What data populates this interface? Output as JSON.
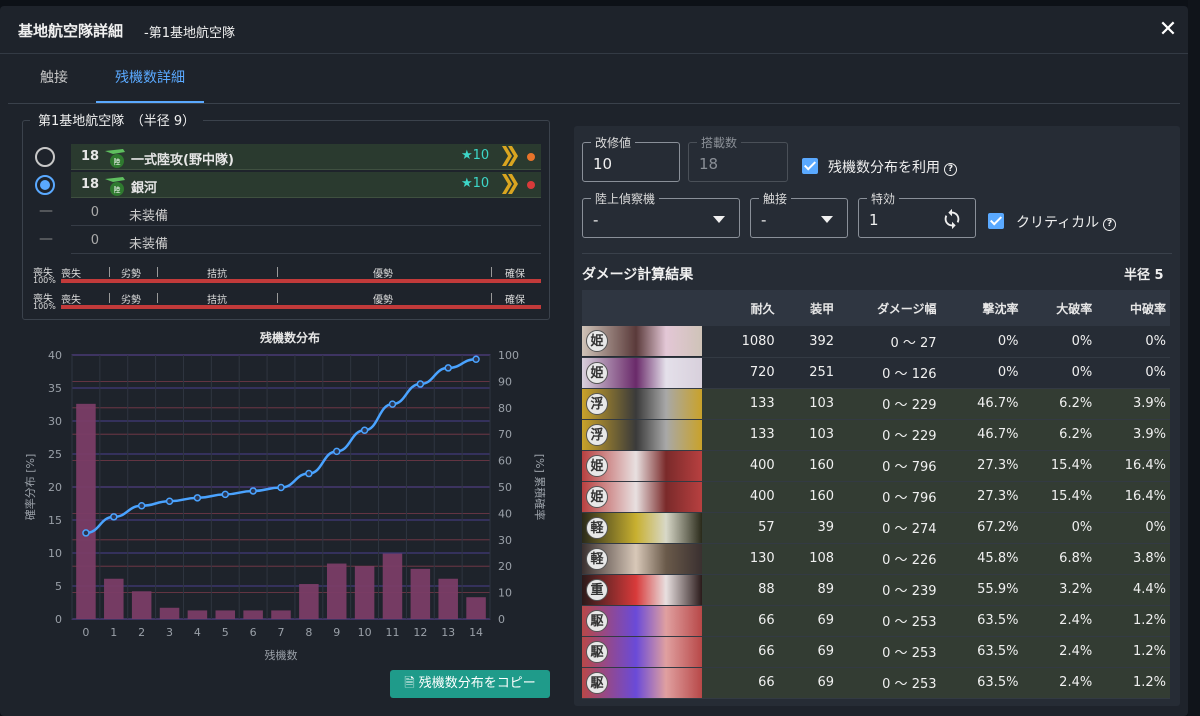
{
  "dialog": {
    "title": "基地航空隊詳細",
    "subtitle": "-第1基地航空隊",
    "close_icon": "close-icon"
  },
  "tabs": [
    {
      "label": "触接"
    },
    {
      "label": "残機数詳細"
    }
  ],
  "fleet": {
    "legend": "第1基地航空隊　（半径 9）",
    "slots": [
      {
        "count": "18",
        "name": "一式陸攻(野中隊)",
        "stars": "★10",
        "dot_color": "#e8742a",
        "selected": false
      },
      {
        "count": "18",
        "name": "銀河",
        "stars": "★10",
        "dot_color": "#d83a3a",
        "selected": true
      },
      {
        "count": "0",
        "name": "未装備"
      },
      {
        "count": "0",
        "name": "未装備"
      }
    ],
    "air_state_labels": [
      "喪失",
      "劣勢",
      "拮抗",
      "優勢",
      "確保"
    ],
    "air_state_rows": [
      {
        "label": "喪失",
        "pct": "100%"
      },
      {
        "label": "喪失",
        "pct": "100%"
      }
    ]
  },
  "chart_data": {
    "type": "bar",
    "title": "残機数分布",
    "xlabel": "残機数",
    "ylabel": "確率分布 [%]",
    "y2label": "[%] 累積確率",
    "categories": [
      0,
      1,
      2,
      3,
      4,
      5,
      6,
      7,
      8,
      9,
      10,
      11,
      12,
      13,
      14
    ],
    "ylim": [
      0,
      40
    ],
    "yticks": [
      0,
      5,
      10,
      15,
      20,
      25,
      30,
      35,
      40
    ],
    "y2lim": [
      0,
      100
    ],
    "y2ticks": [
      0,
      10,
      20,
      30,
      40,
      50,
      60,
      70,
      80,
      90,
      100
    ],
    "series": [
      {
        "kind": "bar",
        "color": "#7a3d66",
        "values": [
          32.6,
          6.1,
          4.2,
          1.7,
          1.3,
          1.3,
          1.3,
          1.3,
          5.3,
          8.4,
          8.0,
          9.9,
          7.6,
          6.1,
          3.3
        ]
      },
      {
        "kind": "line",
        "axis": "y2",
        "color": "#4aa3ff",
        "values": [
          32.6,
          38.7,
          42.9,
          44.6,
          45.9,
          47.2,
          48.5,
          49.8,
          55.1,
          63.5,
          71.5,
          81.4,
          89.0,
          95.1,
          98.4
        ]
      }
    ]
  },
  "copy_button": "残機数分布をコピー",
  "form": {
    "kaishu_label": "改修値",
    "kaishu_value": "10",
    "tousai_label": "搭載数",
    "tousai_value": "18",
    "use_dist_label": "残機数分布を利用",
    "rikujou_label": "陸上偵察機",
    "rikujou_value": "-",
    "shokusetsu_label": "触接",
    "shokusetsu_value": "-",
    "tokkou_label": "特効",
    "tokkou_value": "1",
    "critical_label": "クリティカル"
  },
  "results": {
    "title": "ダメージ計算結果",
    "radius": "半径 5",
    "columns": [
      "",
      "耐久",
      "装甲",
      "ダメージ幅",
      "撃沈率",
      "大破率",
      "中破率"
    ],
    "rows": [
      {
        "tag": "姫",
        "hp": "1080",
        "armor": "392",
        "dmg": "0 ～ 27",
        "sink": "0%",
        "taiha": "0%",
        "chuuha": "0%",
        "img": [
          "#cfc3b8",
          "#5a3a3a",
          "#e3c7d6"
        ]
      },
      {
        "tag": "姫",
        "hp": "720",
        "armor": "251",
        "dmg": "0 ～ 126",
        "sink": "0%",
        "taiha": "0%",
        "chuuha": "0%",
        "img": [
          "#d8d0dc",
          "#6a2a6a",
          "#e4e0ea"
        ]
      },
      {
        "tag": "浮",
        "hp": "133",
        "armor": "103",
        "dmg": "0 ～ 229",
        "sink": "46.7%",
        "taiha": "6.2%",
        "chuuha": "3.9%",
        "img": [
          "#c9a22a",
          "#3a3a3a",
          "#a8a8a8"
        ]
      },
      {
        "tag": "浮",
        "hp": "133",
        "armor": "103",
        "dmg": "0 ～ 229",
        "sink": "46.7%",
        "taiha": "6.2%",
        "chuuha": "3.9%",
        "img": [
          "#c9a22a",
          "#3a3a3a",
          "#a8a8a8"
        ]
      },
      {
        "tag": "姫",
        "hp": "400",
        "armor": "160",
        "dmg": "0 ～ 796",
        "sink": "27.3%",
        "taiha": "15.4%",
        "chuuha": "16.4%",
        "img": [
          "#b84040",
          "#e8e0e0",
          "#7a2a2a"
        ]
      },
      {
        "tag": "姫",
        "hp": "400",
        "armor": "160",
        "dmg": "0 ～ 796",
        "sink": "27.3%",
        "taiha": "15.4%",
        "chuuha": "16.4%",
        "img": [
          "#b84040",
          "#e8e0e0",
          "#7a2a2a"
        ]
      },
      {
        "tag": "軽",
        "hp": "57",
        "armor": "39",
        "dmg": "0 ～ 274",
        "sink": "67.2%",
        "taiha": "0%",
        "chuuha": "0%",
        "img": [
          "#2a2a1a",
          "#c8b030",
          "#d8d8c8"
        ]
      },
      {
        "tag": "軽",
        "hp": "130",
        "armor": "108",
        "dmg": "0 ～ 226",
        "sink": "45.8%",
        "taiha": "6.8%",
        "chuuha": "3.8%",
        "img": [
          "#3a3030",
          "#d8c8b8",
          "#6a5a4a"
        ]
      },
      {
        "tag": "重",
        "hp": "88",
        "armor": "89",
        "dmg": "0 ～ 239",
        "sink": "55.9%",
        "taiha": "3.2%",
        "chuuha": "4.4%",
        "img": [
          "#2a1a1a",
          "#d83a3a",
          "#e8e0e0"
        ]
      },
      {
        "tag": "駆",
        "hp": "66",
        "armor": "69",
        "dmg": "0 ～ 253",
        "sink": "63.5%",
        "taiha": "2.4%",
        "chuuha": "1.2%",
        "img": [
          "#b84848",
          "#6a4ad8",
          "#e0a0a0"
        ]
      },
      {
        "tag": "駆",
        "hp": "66",
        "armor": "69",
        "dmg": "0 ～ 253",
        "sink": "63.5%",
        "taiha": "2.4%",
        "chuuha": "1.2%",
        "img": [
          "#b84848",
          "#6a4ad8",
          "#e0a0a0"
        ]
      },
      {
        "tag": "駆",
        "hp": "66",
        "armor": "69",
        "dmg": "0 ～ 253",
        "sink": "63.5%",
        "taiha": "2.4%",
        "chuuha": "1.2%",
        "img": [
          "#b84848",
          "#6a4ad8",
          "#e0a0a0"
        ]
      }
    ]
  }
}
